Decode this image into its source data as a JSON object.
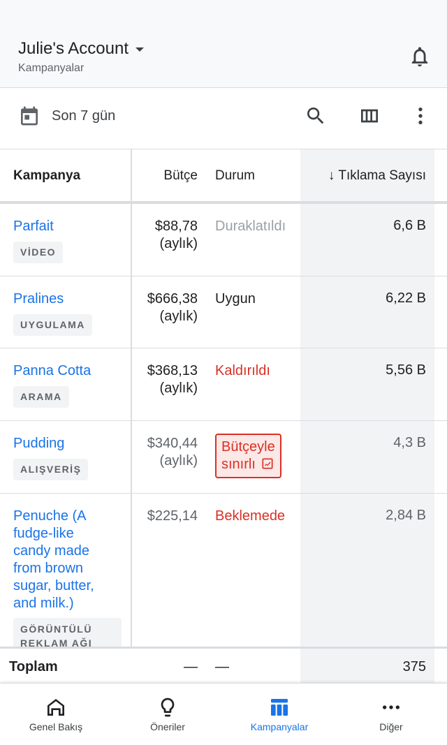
{
  "header": {
    "account_name": "Julie's Account",
    "subtitle": "Kampanyalar"
  },
  "toolbar": {
    "date_range": "Son 7 gün"
  },
  "table": {
    "columns": [
      "Kampanya",
      "Bütçe",
      "Durum",
      "Tıklama Sayısı"
    ],
    "sort_arrow": "↓",
    "rows": [
      {
        "name": "Parfait",
        "type": "VİDEO",
        "budget_amount": "$88,78",
        "budget_period": "(aylık)",
        "status": "Duraklatıldı",
        "clicks": "6,6 B"
      },
      {
        "name": "Pralines",
        "type": "UYGULAMA",
        "budget_amount": "$666,38",
        "budget_period": "(aylık)",
        "status": "Uygun",
        "clicks": "6,22 B"
      },
      {
        "name": "Panna Cotta",
        "type": "ARAMA",
        "budget_amount": "$368,13",
        "budget_period": "(aylık)",
        "status": "Kaldırıldı",
        "clicks": "5,56 B"
      },
      {
        "name": "Pudding",
        "type": "ALIŞVERİŞ",
        "budget_amount": "$340,44",
        "budget_period": "(aylık)",
        "status_line1": "Bütçeyle",
        "status_line2": "sınırlı",
        "clicks": "4,3 B"
      },
      {
        "name": "Penuche (A fudge-like candy made from brown sugar, butter, and milk.)",
        "name_lines": [
          "Penuche (A",
          "fudge-like",
          "candy made",
          "from brown",
          "sugar, butter,",
          "and milk.)"
        ],
        "type_line1": "GÖRÜNTÜLÜ",
        "type_line2": "REKLAM AĞI",
        "budget_amount": "$225,14",
        "status": "Beklemede",
        "clicks": "2,84 B"
      }
    ],
    "total": {
      "label": "Toplam",
      "budget": "—",
      "status": "—",
      "clicks": "375"
    }
  },
  "bottom_nav": {
    "items": [
      {
        "label": "Genel Bakış",
        "icon": "home-icon"
      },
      {
        "label": "Öneriler",
        "icon": "lightbulb-icon"
      },
      {
        "label": "Kampanyalar",
        "icon": "campaigns-icon",
        "active": true
      },
      {
        "label": "Diğer",
        "icon": "more-horiz-icon"
      }
    ]
  },
  "colors": {
    "link": "#1a73e8",
    "error": "#d93025",
    "muted": "#9aa0a6",
    "sorted_column_bg": "#f1f3f4"
  }
}
